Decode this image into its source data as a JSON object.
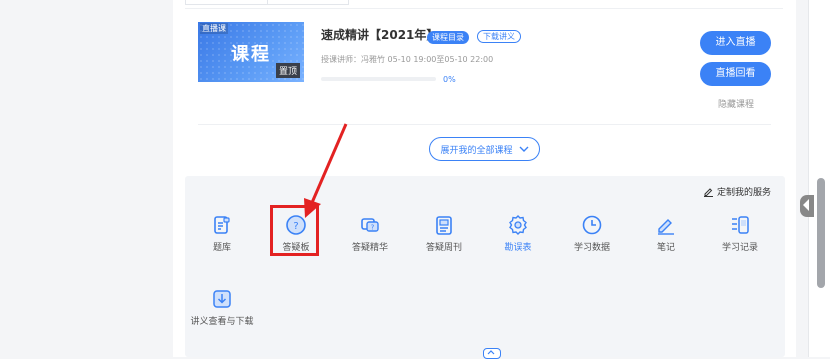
{
  "course": {
    "thumb_tag": "直播课",
    "thumb_text": "课程",
    "thumb_pin": "置顶",
    "title": "速成精讲【2021年】",
    "badge_catalog": "课程目录",
    "badge_handout": "下载讲义",
    "teacher_line": "授课讲师：冯雅竹  05-10 19:00至05-10 22:00",
    "progress_text": "0%",
    "progress_value": 0,
    "enter_label": "进入直播",
    "replay_label": "直播回看",
    "hide_label": "隐藏课程"
  },
  "expand_label": "展开我的全部课程",
  "services": {
    "customize_label": "定制我的服务",
    "items": [
      {
        "label": "题库",
        "icon": "question-bank-icon"
      },
      {
        "label": "答疑板",
        "icon": "qa-board-icon"
      },
      {
        "label": "答疑精华",
        "icon": "qa-highlight-icon"
      },
      {
        "label": "答疑周刊",
        "icon": "qa-weekly-icon"
      },
      {
        "label": "勘误表",
        "icon": "errata-icon"
      },
      {
        "label": "学习数据",
        "icon": "study-data-icon"
      },
      {
        "label": "笔记",
        "icon": "notes-icon"
      },
      {
        "label": "学习记录",
        "icon": "study-record-icon"
      },
      {
        "label": "讲义查看与下载",
        "icon": "handout-download-icon"
      }
    ]
  },
  "colors": {
    "accent": "#3b82f6",
    "highlight": "#e32222"
  }
}
